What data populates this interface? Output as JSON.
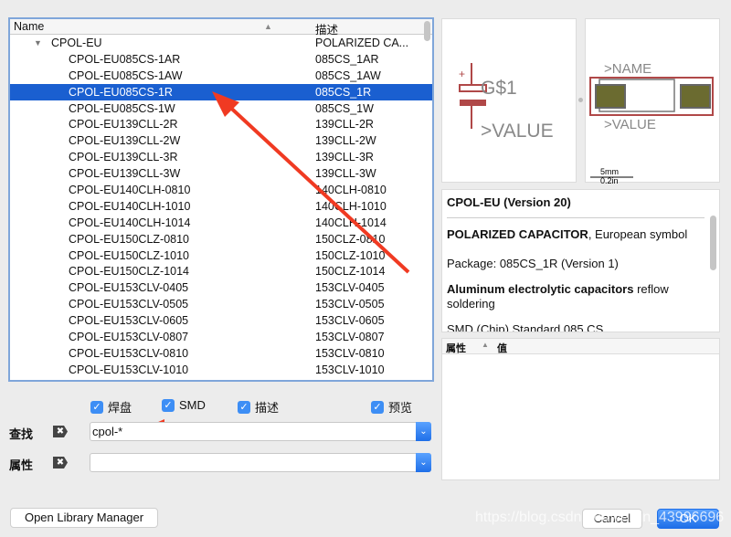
{
  "list": {
    "col_name": "Name",
    "col_desc": "描述",
    "sort_icon": "triangle-up",
    "group": {
      "name": "CPOL-EU",
      "desc": "POLARIZED CA..."
    },
    "items": [
      {
        "name": "CPOL-EU085CS-1AR",
        "desc": "085CS_1AR"
      },
      {
        "name": "CPOL-EU085CS-1AW",
        "desc": "085CS_1AW"
      },
      {
        "name": "CPOL-EU085CS-1R",
        "desc": "085CS_1R",
        "selected": true
      },
      {
        "name": "CPOL-EU085CS-1W",
        "desc": "085CS_1W"
      },
      {
        "name": "CPOL-EU139CLL-2R",
        "desc": "139CLL-2R"
      },
      {
        "name": "CPOL-EU139CLL-2W",
        "desc": "139CLL-2W"
      },
      {
        "name": "CPOL-EU139CLL-3R",
        "desc": "139CLL-3R"
      },
      {
        "name": "CPOL-EU139CLL-3W",
        "desc": "139CLL-3W"
      },
      {
        "name": "CPOL-EU140CLH-0810",
        "desc": "140CLH-0810"
      },
      {
        "name": "CPOL-EU140CLH-1010",
        "desc": "140CLH-1010"
      },
      {
        "name": "CPOL-EU140CLH-1014",
        "desc": "140CLH-1014"
      },
      {
        "name": "CPOL-EU150CLZ-0810",
        "desc": "150CLZ-0810"
      },
      {
        "name": "CPOL-EU150CLZ-1010",
        "desc": "150CLZ-1010"
      },
      {
        "name": "CPOL-EU150CLZ-1014",
        "desc": "150CLZ-1014"
      },
      {
        "name": "CPOL-EU153CLV-0405",
        "desc": "153CLV-0405"
      },
      {
        "name": "CPOL-EU153CLV-0505",
        "desc": "153CLV-0505"
      },
      {
        "name": "CPOL-EU153CLV-0605",
        "desc": "153CLV-0605"
      },
      {
        "name": "CPOL-EU153CLV-0807",
        "desc": "153CLV-0807"
      },
      {
        "name": "CPOL-EU153CLV-0810",
        "desc": "153CLV-0810"
      },
      {
        "name": "CPOL-EU153CLV-1010",
        "desc": "153CLV-1010"
      }
    ]
  },
  "filters": {
    "pads": "焊盘",
    "smd": "SMD",
    "desc": "描述",
    "preview": "预览"
  },
  "search": {
    "label": "查找",
    "value": "cpol-*"
  },
  "attr": {
    "label": "属性",
    "value": ""
  },
  "symbol": {
    "name": "G$1",
    "value": ">VALUE",
    "plus": "+"
  },
  "package": {
    "name": ">NAME",
    "value": ">VALUE",
    "scale_mm": "5mm",
    "scale_in": "0.2in"
  },
  "info": {
    "title": "CPOL-EU (Version 20)",
    "desc_bold": "POLARIZED CAPACITOR",
    "desc_rest": ", European symbol",
    "package": "Package: 085CS_1R (Version 1)",
    "tech_bold": "Aluminum electrolytic capacitors",
    "tech_rest": " reflow soldering",
    "smd": "SMD (Chip) Standard 085 CS"
  },
  "props": {
    "col_attr": "属性",
    "col_value": "值"
  },
  "buttons": {
    "library_manager": "Open Library Manager",
    "cancel": "Cancel",
    "ok": "OK"
  },
  "watermark": "https://blog.csdn.net/weixin_43996696",
  "colors": {
    "selection": "#1a5fd0",
    "annotation_arrow": "#f03a22",
    "symbol": "#b04848"
  }
}
